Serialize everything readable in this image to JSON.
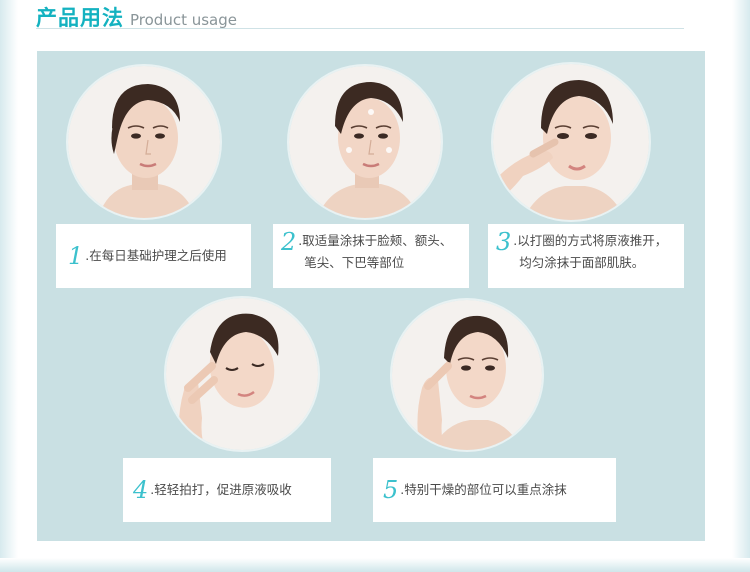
{
  "header": {
    "title_cn": "产品用法",
    "title_en": "Product usage"
  },
  "steps": [
    {
      "num": "1",
      "text": ".在每日基础护理之后使用"
    },
    {
      "num": "2",
      "line1": ".取适量涂抹于脸颊、额头、",
      "line2": "笔尖、下巴等部位"
    },
    {
      "num": "3",
      "line1": ".以打圈的方式将原液推开，",
      "line2": "均匀涂抹于面部肌肤。"
    },
    {
      "num": "4",
      "text": ".轻轻拍打，促进原液吸收"
    },
    {
      "num": "5",
      "text": ".特别干燥的部位可以重点涂抹"
    }
  ],
  "colors": {
    "accent": "#14b2c0",
    "panel": "#c9e0e3",
    "number": "#3cc1cd"
  }
}
